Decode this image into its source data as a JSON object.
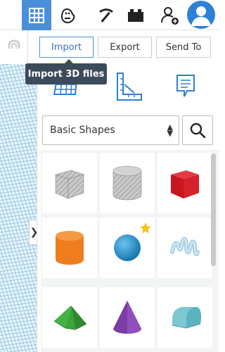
{
  "toolbar": {
    "icons": [
      "grid-view-icon",
      "hand-icon",
      "pickaxe-icon",
      "brick-icon",
      "add-user-icon",
      "avatar-icon"
    ],
    "accent_color": "#4a90d9"
  },
  "actions": {
    "import_label": "Import",
    "export_label": "Export",
    "sendto_label": "Send To"
  },
  "tooltip": {
    "text": "Import 3D files"
  },
  "panel": {
    "type_icons": [
      "workplane-icon",
      "ruler-icon",
      "notes-icon"
    ],
    "category_select": {
      "value": "Basic Shapes"
    },
    "shapes": [
      {
        "name": "box-hole",
        "icon": "box-hole-icon",
        "color": "#b7b7b7"
      },
      {
        "name": "cylinder-hole",
        "icon": "cylinder-hole-icon",
        "color": "#b7b7b7"
      },
      {
        "name": "box",
        "icon": "box-icon",
        "color": "#d6202b"
      },
      {
        "name": "cylinder",
        "icon": "cylinder-icon",
        "color": "#ef7d1d"
      },
      {
        "name": "sphere",
        "icon": "sphere-icon",
        "color": "#1e8fd0",
        "starred": true
      },
      {
        "name": "scribble",
        "icon": "scribble-icon",
        "color": "#a9cfe6"
      },
      {
        "name": "roof",
        "icon": "roof-icon",
        "color": "#3aa53a"
      },
      {
        "name": "cone",
        "icon": "cone-icon",
        "color": "#7b3da6"
      },
      {
        "name": "round-roof",
        "icon": "round-roof-icon",
        "color": "#5bb3bf"
      }
    ]
  }
}
